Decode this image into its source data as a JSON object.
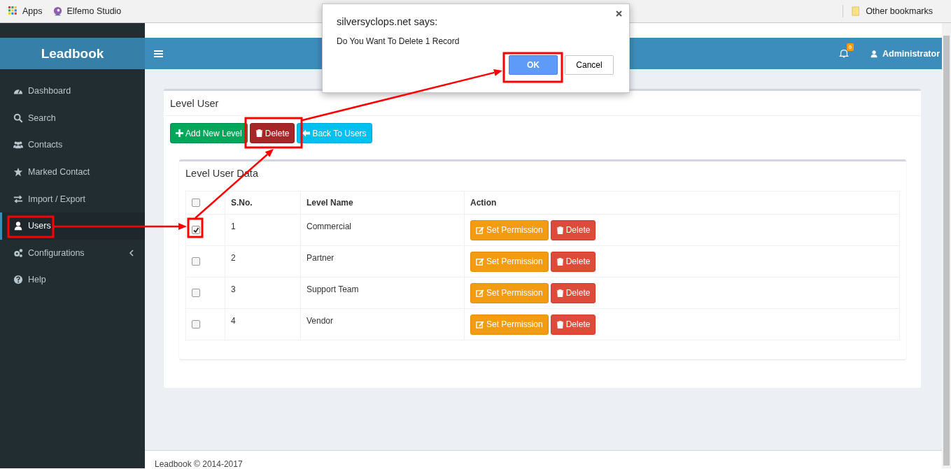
{
  "browser": {
    "bookmarks": [
      {
        "label": "Apps",
        "kind": "apps"
      },
      {
        "label": "Elfemo Studio",
        "kind": "site"
      }
    ],
    "other_bookmarks": "Other bookmarks"
  },
  "sidebar": {
    "logo": "Leadbook",
    "items": [
      {
        "label": "Dashboard",
        "kind": "dashboard",
        "selected": false,
        "submenu": false
      },
      {
        "label": "Search",
        "kind": "search",
        "selected": false,
        "submenu": false
      },
      {
        "label": "Contacts",
        "kind": "contacts",
        "selected": false,
        "submenu": false
      },
      {
        "label": "Marked Contact",
        "kind": "star",
        "selected": false,
        "submenu": false
      },
      {
        "label": "Import / Export",
        "kind": "exchange",
        "selected": false,
        "submenu": false
      },
      {
        "label": "Users",
        "kind": "user",
        "selected": true,
        "submenu": false
      },
      {
        "label": "Configurations",
        "kind": "gears",
        "selected": false,
        "submenu": true
      },
      {
        "label": "Help",
        "kind": "help",
        "selected": false,
        "submenu": false
      }
    ]
  },
  "header": {
    "notifications": "0",
    "user": "Administrator"
  },
  "panel": {
    "title": "Level User",
    "buttons": [
      {
        "label": "Add New Level",
        "kind": "add"
      },
      {
        "label": "Delete",
        "kind": "delete"
      },
      {
        "label": "Back To Users",
        "kind": "back"
      }
    ],
    "table": {
      "title": "Level User Data",
      "select_all": {
        "checked": false
      },
      "columns": [
        "S.No.",
        "Level Name",
        "Action"
      ],
      "rows": [
        {
          "checked": true,
          "sno": "1",
          "name": "Commercial",
          "actions": [
            "Set Permission",
            "Delete"
          ]
        },
        {
          "checked": false,
          "sno": "2",
          "name": "Partner",
          "actions": [
            "Set Permission",
            "Delete"
          ]
        },
        {
          "checked": false,
          "sno": "3",
          "name": "Support Team",
          "actions": [
            "Set Permission",
            "Delete"
          ]
        },
        {
          "checked": false,
          "sno": "4",
          "name": "Vendor",
          "actions": [
            "Set Permission",
            "Delete"
          ]
        }
      ]
    }
  },
  "footer": "Leadbook © 2014-2017",
  "dialog": {
    "title": "silversyclops.net says:",
    "message": "Do You Want To Delete 1 Record",
    "buttons": [
      {
        "label": "OK",
        "kind": "primary"
      },
      {
        "label": "Cancel",
        "kind": "secondary"
      }
    ]
  }
}
